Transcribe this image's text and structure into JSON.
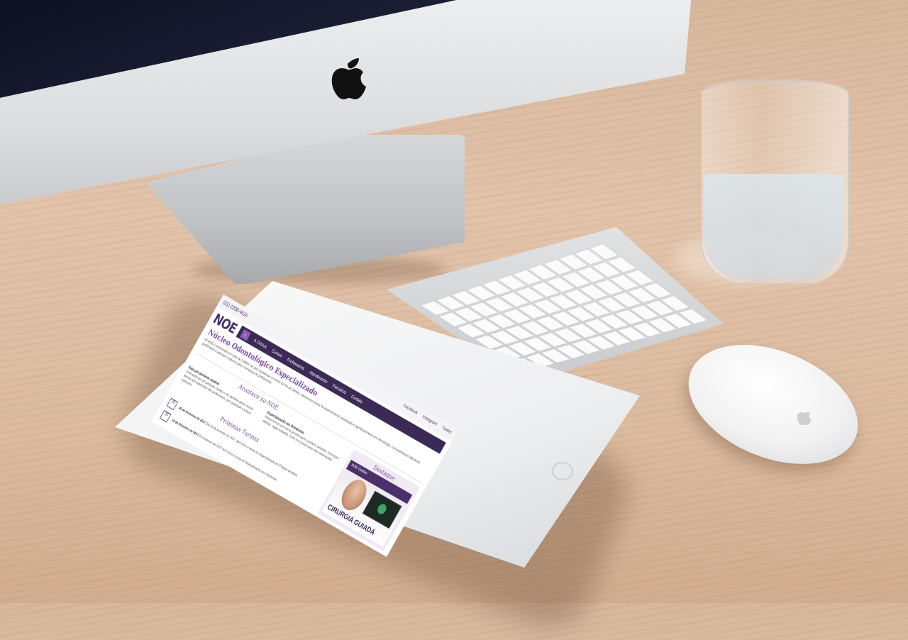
{
  "scene": {
    "surface": "wooden desk",
    "objects": [
      "imac",
      "glass-of-water",
      "keyboard",
      "mouse",
      "ipad"
    ]
  },
  "tablet_site": {
    "topbar": {
      "phone": "(21) 2238-4616",
      "links": [
        "Facebook",
        "Instagram",
        "Twitter"
      ]
    },
    "logo": "NOE",
    "nav": {
      "home_glyph": "⌂",
      "items": [
        "A Clínica",
        "Cursos",
        "Professores",
        "Atendimento",
        "Parceiros",
        "Contato"
      ]
    },
    "hero": {
      "title": "Núcleo Odontológico Especializado",
      "intro": "Há NOE é estruturado em mais de 1.500m² de área construída no centro do Rio de Janeiro, oferecendo cursos de especialização, atualização e aperfeiçoamento em Odontologia, com professores altamente qualificados e estrutura moderna para a formação de profissionais."
    },
    "news": {
      "title": "Acontece no NOE",
      "items": [
        {
          "heading": "Seja um paciente modelo",
          "text": "Você pode ser um paciente modelo e ser atendido pelos nossos alunos sob supervisão dos professores, com qualidade e preços especiais."
        },
        {
          "heading": "Especialização em Ortodontia",
          "text": "Novas turmas com início previsto para o primeiro semestre. Inscrições abertas, vagas limitadas. Entre em contato para mais informações."
        }
      ]
    },
    "turmas": {
      "title": "Próximas Turmas",
      "items": [
        {
          "day": "20",
          "date": "20 de Fevereiro de 2017",
          "text": "Dia 20 de fevereiro de 2017, terá início a turma de Especialização em Prótese Dentária."
        },
        {
          "day": "18",
          "date": "18 de Fevereiro de 2017",
          "text": "Em fevereiro de 2017 terá início a turma de Especialização em Ortodontia."
        }
      ]
    },
    "destaque": {
      "title": "Destaque",
      "promo_brand": "NOE Guides",
      "promo_title": "CIRURGIA GUIADA"
    }
  }
}
